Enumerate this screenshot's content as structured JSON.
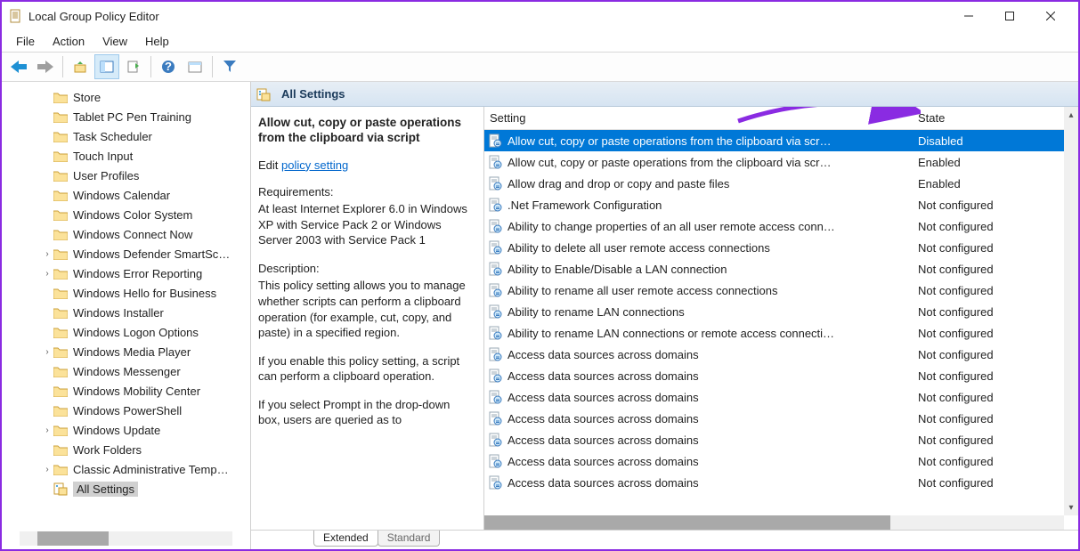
{
  "window": {
    "title": "Local Group Policy Editor"
  },
  "menu": {
    "file": "File",
    "action": "Action",
    "view": "View",
    "help": "Help"
  },
  "tree": {
    "items": [
      {
        "label": "Store",
        "lvl": 1,
        "exp": ""
      },
      {
        "label": "Tablet PC Pen Training",
        "lvl": 1,
        "exp": ""
      },
      {
        "label": "Task Scheduler",
        "lvl": 1,
        "exp": ""
      },
      {
        "label": "Touch Input",
        "lvl": 1,
        "exp": ""
      },
      {
        "label": "User Profiles",
        "lvl": 1,
        "exp": ""
      },
      {
        "label": "Windows Calendar",
        "lvl": 1,
        "exp": ""
      },
      {
        "label": "Windows Color System",
        "lvl": 1,
        "exp": ""
      },
      {
        "label": "Windows Connect Now",
        "lvl": 1,
        "exp": ""
      },
      {
        "label": "Windows Defender SmartSc…",
        "lvl": 1,
        "exp": ">"
      },
      {
        "label": "Windows Error Reporting",
        "lvl": 1,
        "exp": ">"
      },
      {
        "label": "Windows Hello for Business",
        "lvl": 1,
        "exp": ""
      },
      {
        "label": "Windows Installer",
        "lvl": 1,
        "exp": ""
      },
      {
        "label": "Windows Logon Options",
        "lvl": 1,
        "exp": ""
      },
      {
        "label": "Windows Media Player",
        "lvl": 1,
        "exp": ">"
      },
      {
        "label": "Windows Messenger",
        "lvl": 1,
        "exp": ""
      },
      {
        "label": "Windows Mobility Center",
        "lvl": 1,
        "exp": ""
      },
      {
        "label": "Windows PowerShell",
        "lvl": 1,
        "exp": ""
      },
      {
        "label": "Windows Update",
        "lvl": 1,
        "exp": ">"
      },
      {
        "label": "Work Folders",
        "lvl": 1,
        "exp": ""
      },
      {
        "label": "Classic Administrative Temp…",
        "lvl": 1,
        "exp": ">"
      }
    ],
    "selected_label": "All Settings"
  },
  "header": {
    "title": "All Settings"
  },
  "desc": {
    "title": "Allow cut, copy or paste operations from the clipboard via script",
    "edit_prefix": "Edit",
    "edit_link": "policy setting",
    "req_label": "Requirements:",
    "req_body": "At least Internet Explorer 6.0 in Windows XP with Service Pack 2 or Windows Server 2003 with Service Pack 1",
    "desc_label": "Description:",
    "desc_body": "This policy setting allows you to manage whether scripts can perform a clipboard operation (for example, cut, copy, and paste) in a specified region.",
    "para2": "If you enable this policy setting, a script can perform a clipboard operation.",
    "para3": "If you select Prompt in the drop-down box, users are queried as to"
  },
  "columns": {
    "setting": "Setting",
    "state": "State"
  },
  "rows": [
    {
      "name": "Allow cut, copy or paste operations from the clipboard via scr…",
      "state": "Disabled",
      "selected": true
    },
    {
      "name": "Allow cut, copy or paste operations from the clipboard via scr…",
      "state": "Enabled"
    },
    {
      "name": "Allow drag and drop or copy and paste files",
      "state": "Enabled"
    },
    {
      "name": ".Net Framework Configuration",
      "state": "Not configured"
    },
    {
      "name": "Ability to change properties of an all user remote access conn…",
      "state": "Not configured"
    },
    {
      "name": "Ability to delete all user remote access connections",
      "state": "Not configured"
    },
    {
      "name": "Ability to Enable/Disable a LAN connection",
      "state": "Not configured"
    },
    {
      "name": "Ability to rename all user remote access connections",
      "state": "Not configured"
    },
    {
      "name": "Ability to rename LAN connections",
      "state": "Not configured"
    },
    {
      "name": "Ability to rename LAN connections or remote access connecti…",
      "state": "Not configured"
    },
    {
      "name": "Access data sources across domains",
      "state": "Not configured"
    },
    {
      "name": "Access data sources across domains",
      "state": "Not configured"
    },
    {
      "name": "Access data sources across domains",
      "state": "Not configured"
    },
    {
      "name": "Access data sources across domains",
      "state": "Not configured"
    },
    {
      "name": "Access data sources across domains",
      "state": "Not configured"
    },
    {
      "name": "Access data sources across domains",
      "state": "Not configured"
    },
    {
      "name": "Access data sources across domains",
      "state": "Not configured"
    }
  ],
  "tabs": {
    "extended": "Extended",
    "standard": "Standard"
  }
}
